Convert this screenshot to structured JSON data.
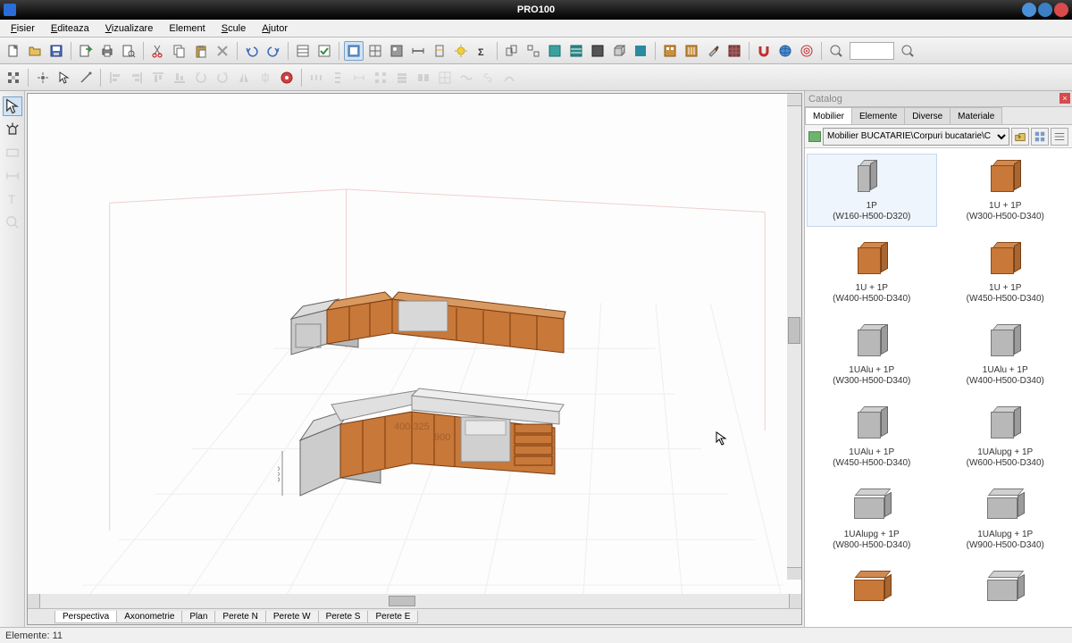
{
  "titlebar": {
    "title": "PRO100"
  },
  "menu": {
    "items": [
      "Fisier",
      "Editeaza",
      "Vizualizare",
      "Element",
      "Scule",
      "Ajutor"
    ]
  },
  "catalog": {
    "header": "Catalog",
    "tabs": [
      "Mobilier",
      "Elemente",
      "Diverse",
      "Materiale"
    ],
    "active_tab": 0,
    "path": "Mobilier BUCATARIE\\Corpuri bucatarie\\C",
    "items": [
      {
        "line1": "1P",
        "line2": "(W160-H500-D320)",
        "color": "gray",
        "shape": "narrow",
        "selected": true
      },
      {
        "line1": "1U + 1P",
        "line2": "(W300-H500-D340)",
        "color": "orange",
        "shape": "normal"
      },
      {
        "line1": "1U + 1P",
        "line2": "(W400-H500-D340)",
        "color": "orange",
        "shape": "normal"
      },
      {
        "line1": "1U + 1P",
        "line2": "(W450-H500-D340)",
        "color": "orange",
        "shape": "normal"
      },
      {
        "line1": "1UAlu + 1P",
        "line2": "(W300-H500-D340)",
        "color": "gray",
        "shape": "normal"
      },
      {
        "line1": "1UAlu + 1P",
        "line2": "(W400-H500-D340)",
        "color": "gray",
        "shape": "normal"
      },
      {
        "line1": "1UAlu + 1P",
        "line2": "(W450-H500-D340)",
        "color": "gray",
        "shape": "normal"
      },
      {
        "line1": "1UAlupg + 1P",
        "line2": "(W600-H500-D340)",
        "color": "gray",
        "shape": "normal"
      },
      {
        "line1": "1UAlupg + 1P",
        "line2": "(W800-H500-D340)",
        "color": "gray",
        "shape": "wide"
      },
      {
        "line1": "1UAlupg + 1P",
        "line2": "(W900-H500-D340)",
        "color": "gray",
        "shape": "wide"
      },
      {
        "line1": "",
        "line2": "",
        "color": "orange",
        "shape": "wide"
      },
      {
        "line1": "",
        "line2": "",
        "color": "gray",
        "shape": "wide"
      }
    ]
  },
  "view_tabs": {
    "items": [
      "Perspectiva",
      "Axonometrie",
      "Plan",
      "Perete N",
      "Perete W",
      "Perete S",
      "Perete E"
    ],
    "active": 0
  },
  "statusbar": {
    "text": "Elemente: 11"
  }
}
